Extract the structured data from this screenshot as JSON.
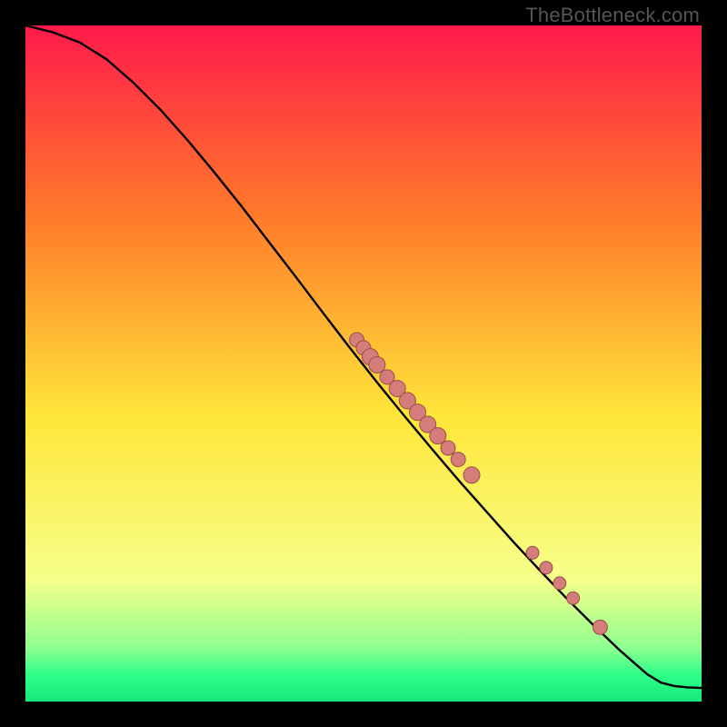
{
  "watermark": "TheBottleneck.com",
  "colors": {
    "gradient_top": "#ff1a4b",
    "gradient_mid_upper": "#ff7a2a",
    "gradient_mid": "#ffe73a",
    "gradient_mid_lower": "#f6ff8a",
    "gradient_green1": "#8fff8f",
    "gradient_green2": "#2dff88",
    "gradient_green3": "#18e87a",
    "curve_stroke": "#000000",
    "dot_fill": "#d47d7a",
    "dot_stroke": "#9a4e4c"
  },
  "chart_data": {
    "type": "line",
    "title": "",
    "xlabel": "",
    "ylabel": "",
    "xlim": [
      0,
      100
    ],
    "ylim": [
      0,
      100
    ],
    "x": [
      0,
      4,
      8,
      12,
      16,
      20,
      24,
      28,
      32,
      36,
      40,
      44,
      48,
      52,
      56,
      60,
      64,
      68,
      72,
      76,
      80,
      84,
      88,
      92,
      94,
      96,
      98,
      100
    ],
    "y": [
      100,
      99,
      97.5,
      95,
      91.5,
      87.5,
      83,
      78.2,
      73.2,
      68,
      62.8,
      57.5,
      52.3,
      47.2,
      42.3,
      37.5,
      32.8,
      28.3,
      23.8,
      19.5,
      15.3,
      11.3,
      7.5,
      4.0,
      2.8,
      2.3,
      2.1,
      2.0
    ],
    "dot_series": {
      "x": [
        49,
        50,
        51,
        52,
        53.5,
        55,
        56.5,
        58,
        59.5,
        61,
        62.5,
        64,
        66,
        75,
        77,
        79,
        81,
        85
      ],
      "y": [
        53.5,
        52.3,
        51.0,
        49.8,
        48.0,
        46.3,
        44.5,
        42.8,
        41.0,
        39.3,
        37.5,
        35.8,
        33.5,
        22.0,
        19.8,
        17.5,
        15.3,
        11.0
      ],
      "r": [
        8,
        8,
        9,
        9,
        8,
        9,
        9,
        9,
        9,
        9,
        8,
        8,
        9,
        7,
        7,
        7,
        7,
        8
      ]
    }
  }
}
